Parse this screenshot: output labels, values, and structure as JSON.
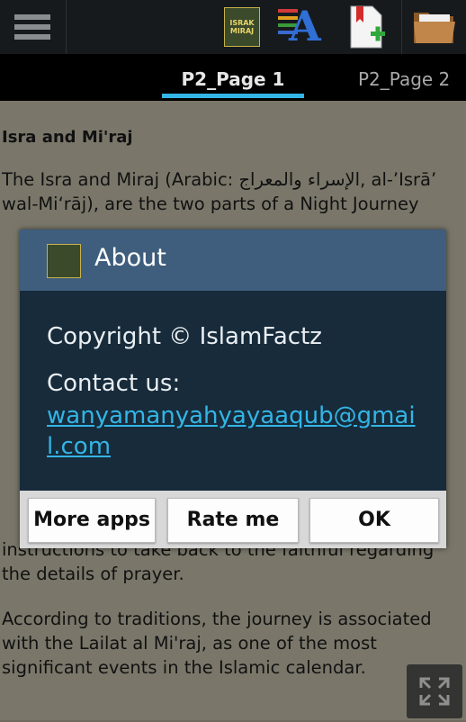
{
  "actionbar": {
    "menu_icon": "hamburger-icon",
    "app_logo_text": "ISRAK MIRAJ",
    "font_icon_letter": "A",
    "icons": [
      "app-logo-icon",
      "font-size-icon",
      "add-bookmark-icon",
      "folder-icon"
    ]
  },
  "tabs": [
    {
      "label": "P2_Page 1",
      "selected": true
    },
    {
      "label": "P2_Page 2",
      "selected": false
    }
  ],
  "article": {
    "title": "Isra and Mi'raj",
    "paragraphs": [
      "The Isra and Miraj (Arabic: الإسراء والمعراج, al-’Isrā’",
      "wal-Mi‘rāj), are the two parts of a Night Journey",
      "instructions to take back to the faithful regarding",
      "the details of prayer.",
      "According to traditions, the journey is associated",
      "with the Lailat al Mi'raj, as one of the most",
      "significant events in the Islamic calendar."
    ]
  },
  "dialog": {
    "title": "About",
    "copyright": "Copyright © IslamFactz",
    "contact_label": "Contact us:",
    "email": "wanyamanyahyayaaqub@gmail.com",
    "buttons": [
      "More apps",
      "Rate me",
      "OK"
    ]
  },
  "colors": {
    "accent": "#33b5e5",
    "dialog_header": "#3f5e7d",
    "dialog_body": "#172b3b",
    "actionbar": "#161a1d"
  }
}
